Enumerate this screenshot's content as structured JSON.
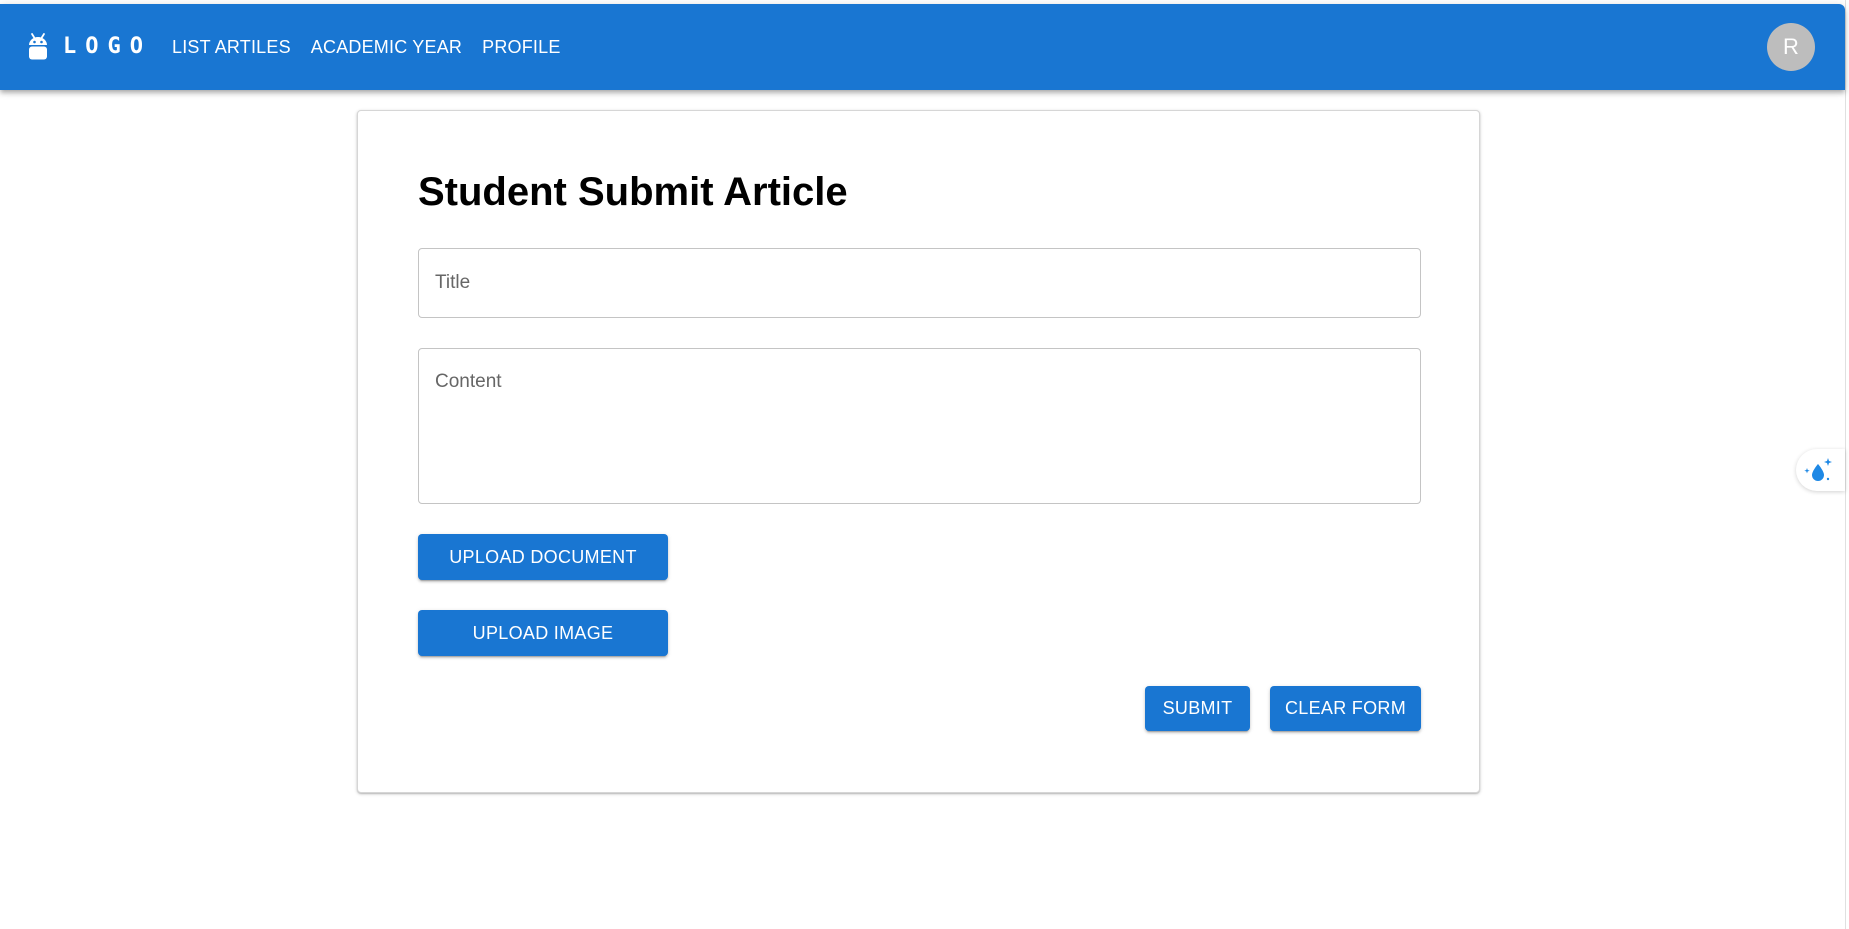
{
  "appbar": {
    "logo_text": "LOGO",
    "logo_icon": "android-icon",
    "nav": [
      {
        "label": "LIST ARTILES"
      },
      {
        "label": "ACADEMIC YEAR"
      },
      {
        "label": "PROFILE"
      }
    ],
    "avatar_initial": "R",
    "bg_color": "#1976d2"
  },
  "form": {
    "title": "Student Submit Article",
    "title_field": {
      "placeholder": "Title",
      "value": ""
    },
    "content_field": {
      "placeholder": "Content",
      "value": ""
    },
    "upload_document_label": "UPLOAD DOCUMENT",
    "upload_image_label": "UPLOAD IMAGE",
    "submit_label": "SUBMIT",
    "clear_label": "CLEAR FORM"
  },
  "side_widget": {
    "icon": "sparkle-drop-icon",
    "accent": "#1e88e5"
  }
}
